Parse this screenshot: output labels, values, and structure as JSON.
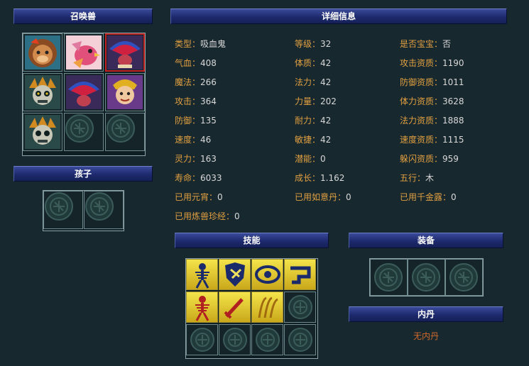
{
  "panels": {
    "summons_title": "召唤兽",
    "children_title": "孩子",
    "detail_title": "详细信息",
    "skills_title": "技能",
    "equipment_title": "装备",
    "inner_pill_title": "内丹",
    "inner_pill_empty": "无内丹"
  },
  "details": [
    {
      "label": "类型：",
      "value": "吸血鬼"
    },
    {
      "label": "等级：",
      "value": "32"
    },
    {
      "label": "是否宝宝：",
      "value": "否"
    },
    {
      "label": "气血：",
      "value": "408"
    },
    {
      "label": "体质：",
      "value": "42"
    },
    {
      "label": "攻击资质：",
      "value": "1190"
    },
    {
      "label": "魔法：",
      "value": "266"
    },
    {
      "label": "法力：",
      "value": "42"
    },
    {
      "label": "防御资质：",
      "value": "1011"
    },
    {
      "label": "攻击：",
      "value": "364"
    },
    {
      "label": "力量：",
      "value": "202"
    },
    {
      "label": "体力资质：",
      "value": "3628"
    },
    {
      "label": "防御：",
      "value": "135"
    },
    {
      "label": "耐力：",
      "value": "42"
    },
    {
      "label": "法力资质：",
      "value": "1888"
    },
    {
      "label": "速度：",
      "value": "46"
    },
    {
      "label": "敏捷：",
      "value": "42"
    },
    {
      "label": "速度资质：",
      "value": "1115"
    },
    {
      "label": "灵力：",
      "value": "163"
    },
    {
      "label": "潜能：",
      "value": "0"
    },
    {
      "label": "躲闪资质：",
      "value": "959"
    },
    {
      "label": "寿命：",
      "value": "6033"
    },
    {
      "label": "成长：",
      "value": "1.162"
    },
    {
      "label": "五行：",
      "value": "木"
    },
    {
      "label": "已用元宵：",
      "value": "0"
    },
    {
      "label": "已用如意丹：",
      "value": "0"
    },
    {
      "label": "已用千金露：",
      "value": "0"
    },
    {
      "label": "已用炼兽珍经：",
      "value": "0"
    }
  ],
  "summons": [
    "lion-beast-icon",
    "phoenix-icon",
    "fan-bird-icon",
    "ghost-warrior-icon",
    "fan-bird-icon",
    "monkey-warrior-icon",
    "ghost-warrior-icon",
    "empty",
    "empty"
  ],
  "selected_summon_index": 2,
  "skills": [
    "skeleton-icon",
    "shield-claw-icon",
    "eye-rune-icon",
    "hook-icon",
    "red-skeleton-icon",
    "sword-icon",
    "fire-claw-icon",
    "empty",
    "empty",
    "empty",
    "empty",
    "empty"
  ],
  "colors": {
    "label": "#e0a040",
    "value": "#d8d8d8",
    "bar": "#1e2a6e",
    "empty_text": "#d06a2c"
  }
}
